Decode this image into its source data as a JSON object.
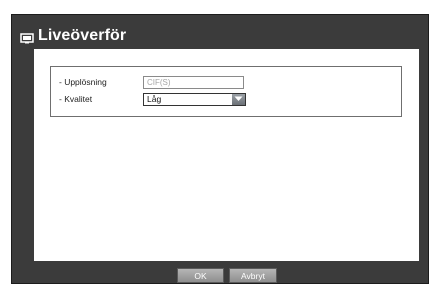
{
  "dialog": {
    "title": "Liveöverför",
    "title_icon": "monitor-icon"
  },
  "settings": {
    "resolution_label": "- Upplösning",
    "resolution_value": "CIF(S)",
    "quality_label": "- Kvalitet",
    "quality_value": "Låg",
    "dropdown_icon": "chevron-down-icon"
  },
  "buttons": {
    "ok_label": "OK",
    "cancel_label": "Avbryt"
  },
  "colors": {
    "frame": "#3b3b3b",
    "panel": "#ffffff",
    "button": "#a3a3a3",
    "disabled_text": "#a6a6a6"
  }
}
